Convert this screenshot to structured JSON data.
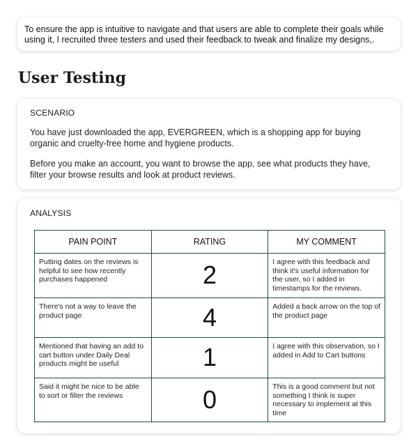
{
  "intro": {
    "text": "To ensure the app is intuitive to navigate and that users are able to complete their goals while using it, I recruited three testers and used their feedback to tweak and finalize my designs,."
  },
  "section": {
    "title": "User Testing"
  },
  "scenario": {
    "heading": "SCENARIO",
    "paragraphs": [
      "You have just downloaded the app, EVERGREEN, which is a shopping app for buying organic and cruelty-free home and hygiene products.",
      "Before you make an account, you want to browse the app, see what products they have, filter your browse results and look at product reviews."
    ]
  },
  "analysis": {
    "heading": "ANALYSIS",
    "columns": [
      "PAIN POINT",
      "RATING",
      "MY COMMENT"
    ],
    "rows": [
      {
        "pain_point": "Putting dates on the reviews is helpful to see how recently purchases happened",
        "rating": "2",
        "comment": "I agree with this feedback and think it's useful information for the user, so I added in timestamps for the reviews."
      },
      {
        "pain_point": "There's not a way to leave the product page",
        "rating": "4",
        "comment": "Added a back arrow on the top of the product page"
      },
      {
        "pain_point": "Mentioned that having an add to cart button under Daily Deal products might be useful",
        "rating": "1",
        "comment": "I agree with this observation, so I added in Add to Cart buttons"
      },
      {
        "pain_point": "Said it might be nice to be able to sort or filter the reviews",
        "rating": "0",
        "comment": "This is a good comment but not something I think is super necessary to implement at this time"
      }
    ]
  }
}
